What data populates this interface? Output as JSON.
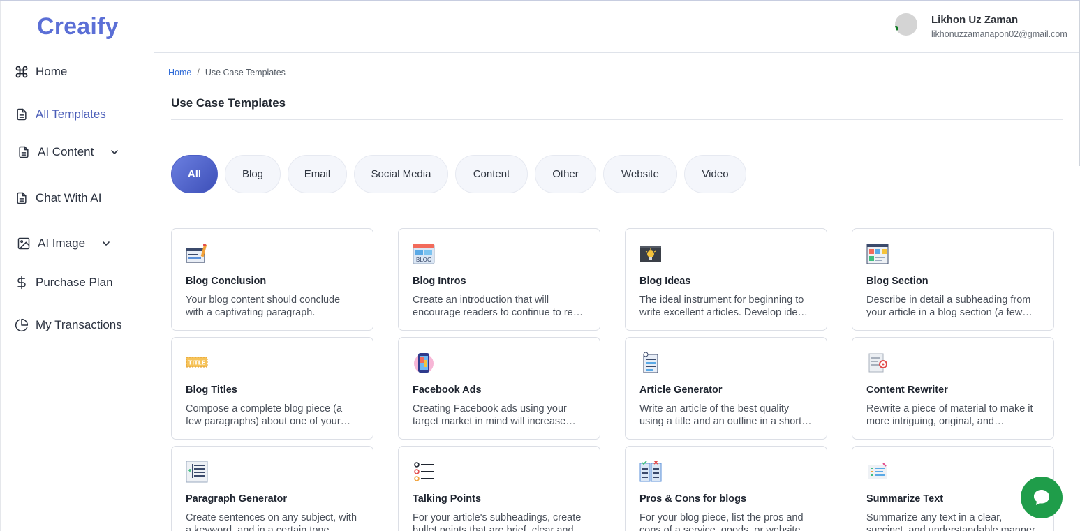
{
  "brand": "Creaify",
  "sidebar": {
    "items": [
      {
        "label": "Home"
      },
      {
        "label": "All Templates"
      },
      {
        "label": "AI Content"
      },
      {
        "label": "Chat With AI"
      },
      {
        "label": "AI Image"
      },
      {
        "label": "Purchase Plan"
      },
      {
        "label": "My Transactions"
      }
    ]
  },
  "user": {
    "name": "Likhon Uz Zaman",
    "email": "likhonuzzamanapon02@gmail.com"
  },
  "breadcrumb": {
    "home": "Home",
    "sep": "/",
    "current": "Use Case Templates"
  },
  "page": {
    "title": "Use Case Templates"
  },
  "filters": [
    "All",
    "Blog",
    "Email",
    "Social Media",
    "Content",
    "Other",
    "Website",
    "Video"
  ],
  "cards": [
    {
      "title": "Blog Conclusion",
      "desc": "Your blog content should conclude with a captivating paragraph.",
      "icon": "blog-conclusion-icon"
    },
    {
      "title": "Blog Intros",
      "desc": "Create an introduction that will encourage readers to continue to read your blog post.",
      "icon": "blog-intros-icon"
    },
    {
      "title": "Blog Ideas",
      "desc": "The ideal instrument for beginning to write excellent articles. Develop ideas for your blog.",
      "icon": "blog-ideas-icon"
    },
    {
      "title": "Blog Section",
      "desc": "Describe in detail a subheading from your article in a blog section (a few paragraphs).",
      "icon": "blog-section-icon"
    },
    {
      "title": "Blog Titles",
      "desc": "Compose a complete blog piece (a few paragraphs) about one of your subheadings.",
      "icon": "blog-titles-icon"
    },
    {
      "title": "Facebook Ads",
      "desc": "Creating Facebook ads using your target market in mind will increase engagement.",
      "icon": "facebook-ads-icon"
    },
    {
      "title": "Article Generator",
      "desc": "Write an article of the best quality using a title and an outline in a short time.",
      "icon": "article-generator-icon"
    },
    {
      "title": "Content Rewriter",
      "desc": "Rewrite a piece of material to make it more intriguing, original, and engaging.",
      "icon": "content-rewriter-icon"
    },
    {
      "title": "Paragraph Generator",
      "desc": "Create sentences on any subject, with a keyword, and in a certain tone.",
      "icon": "paragraph-generator-icon"
    },
    {
      "title": "Talking Points",
      "desc": "For your article's subheadings, create bullet points that are brief, clear and informative.",
      "icon": "talking-points-icon"
    },
    {
      "title": "Pros & Cons for blogs",
      "desc": "For your blog piece, list the pros and cons of a service, goods, or website.",
      "icon": "pros-cons-icon"
    },
    {
      "title": "Summarize Text",
      "desc": "Summarize any text in a clear, succinct, and understandable manner.",
      "icon": "summarize-text-icon"
    }
  ],
  "colors": {
    "brand": "#5b6fd6",
    "active_nav": "#4a5db8",
    "chip_active": "#4c5ec6",
    "chat": "#1f9d4a",
    "link": "#2f6bd8"
  }
}
